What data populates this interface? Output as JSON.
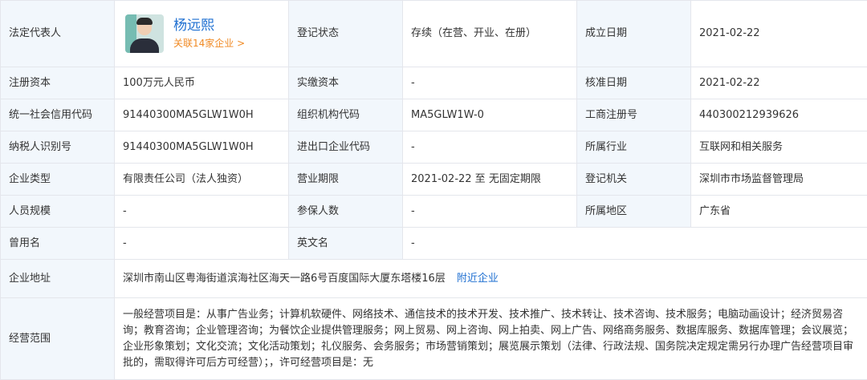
{
  "legal_rep": {
    "label": "法定代表人",
    "name": "杨远熙",
    "related": "关联14家企业 >"
  },
  "fields": {
    "reg_status": {
      "label": "登记状态",
      "value": "存续（在营、开业、在册）"
    },
    "established": {
      "label": "成立日期",
      "value": "2021-02-22"
    },
    "reg_capital": {
      "label": "注册资本",
      "value": "100万元人民币"
    },
    "paid_capital": {
      "label": "实缴资本",
      "value": "-"
    },
    "approval_date": {
      "label": "核准日期",
      "value": "2021-02-22"
    },
    "credit_code": {
      "label": "统一社会信用代码",
      "value": "91440300MA5GLW1W0H"
    },
    "org_code": {
      "label": "组织机构代码",
      "value": "MA5GLW1W-0"
    },
    "biz_reg_no": {
      "label": "工商注册号",
      "value": "440300212939626"
    },
    "taxpayer_id": {
      "label": "纳税人识别号",
      "value": "91440300MA5GLW1W0H"
    },
    "import_export_code": {
      "label": "进出口企业代码",
      "value": "-"
    },
    "industry": {
      "label": "所属行业",
      "value": "互联网和相关服务"
    },
    "company_type": {
      "label": "企业类型",
      "value": "有限责任公司（法人独资）"
    },
    "biz_term": {
      "label": "营业期限",
      "value": "2021-02-22 至 无固定期限"
    },
    "reg_authority": {
      "label": "登记机关",
      "value": "深圳市市场监督管理局"
    },
    "staff_size": {
      "label": "人员规模",
      "value": "-"
    },
    "insured": {
      "label": "参保人数",
      "value": "-"
    },
    "region": {
      "label": "所属地区",
      "value": "广东省"
    },
    "former_name": {
      "label": "曾用名",
      "value": "-"
    },
    "english_name": {
      "label": "英文名",
      "value": "-"
    },
    "address": {
      "label": "企业地址",
      "value": "深圳市南山区粤海街道滨海社区海天一路6号百度国际大厦东塔楼16层",
      "link": "附近企业"
    },
    "scope": {
      "label": "经营范围",
      "value": "一般经营项目是：从事广告业务；计算机软硬件、网络技术、通信技术的技术开发、技术推广、技术转让、技术咨询、技术服务；电脑动画设计；经济贸易咨询；教育咨询；企业管理咨询；为餐饮企业提供管理服务；网上贸易、网上咨询、网上拍卖、网上广告、网络商务服务、数据库服务、数据库管理；会议展览；企业形象策划；文化交流；文化活动策划；礼仪服务、会务服务；市场营销策划；展览展示策划（法律、行政法规、国务院决定规定需另行办理广告经营项目审批的，需取得许可后方可经营）；，许可经营项目是：无"
    }
  }
}
